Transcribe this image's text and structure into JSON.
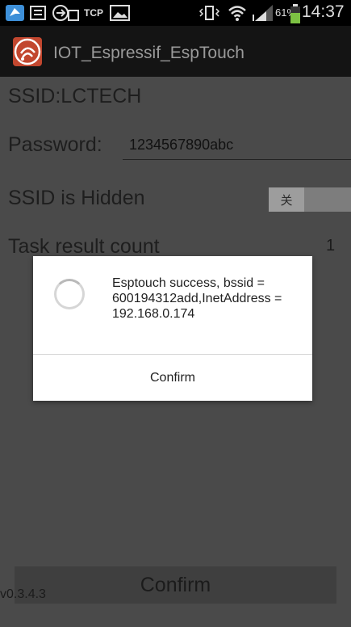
{
  "status_bar": {
    "tcp_label": "TCP",
    "battery_percent": "61%",
    "time": "14:37",
    "icons": [
      "app-notification-icon",
      "sms-icon",
      "tcp-app-icon",
      "image-icon",
      "vibrate-icon",
      "wifi-icon",
      "signal-icon",
      "battery-icon"
    ]
  },
  "action_bar": {
    "title": "IOT_Espressif_EspTouch",
    "brand_color": "#c2472f"
  },
  "form": {
    "ssid": "SSID:LCTECH",
    "password_label": "Password:",
    "password_value": "1234567890abc",
    "hidden_label": "SSID is Hidden",
    "hidden_toggle_state": "关",
    "task_count_label": "Task result count",
    "task_count_value": "1",
    "confirm_label": "Confirm"
  },
  "dialog": {
    "message": "Esptouch success, bssid = 600194312add,InetAddress = 192.168.0.174",
    "button_label": "Confirm"
  },
  "footer": {
    "version": "v0.3.4.3"
  }
}
